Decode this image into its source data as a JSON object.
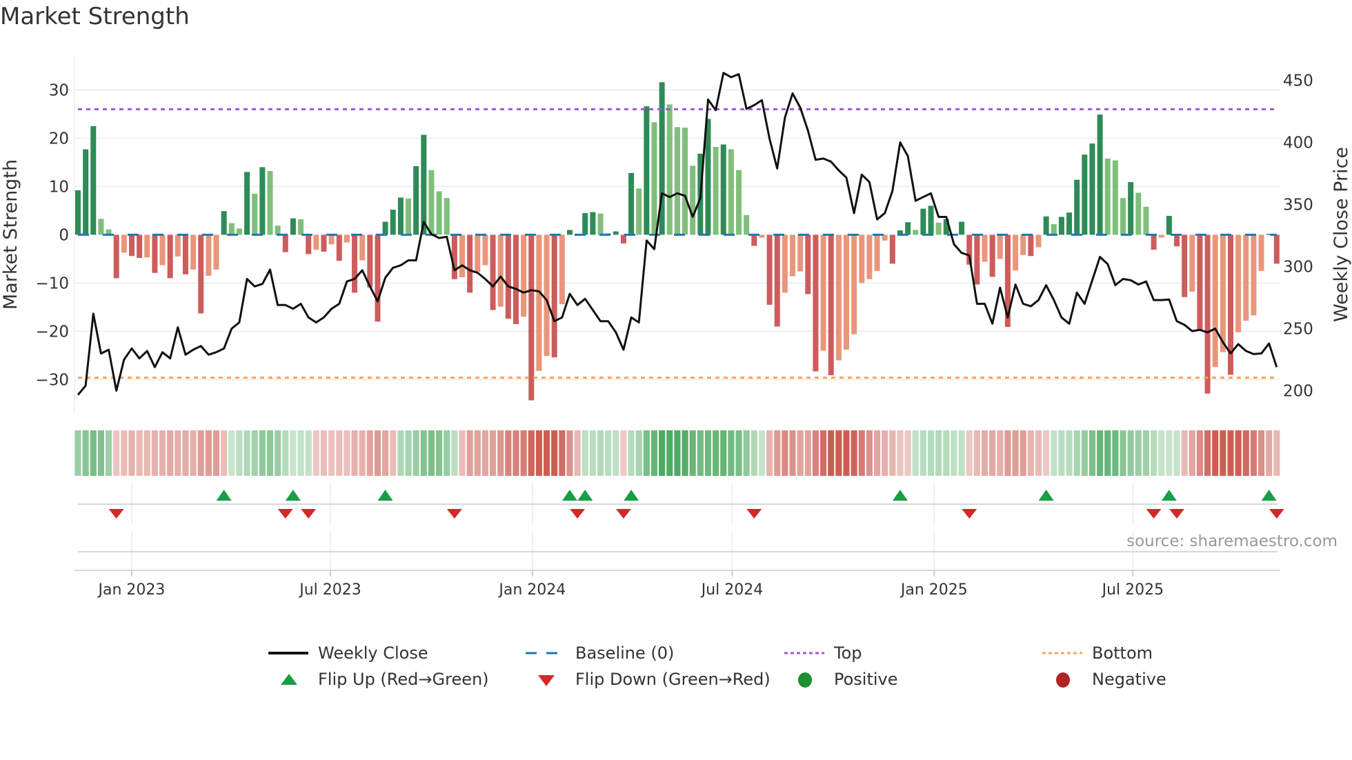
{
  "title": "Market Strength",
  "source": "source: sharemaestro.com",
  "colors": {
    "strong_green": "#2e8b57",
    "weak_green": "#7fbf7b",
    "strong_red": "#cd5c5c",
    "weak_red": "#e9967a",
    "line": "#111111",
    "baseline": "#1f77b4",
    "top": "#9b59d6",
    "bottom": "#f4a460",
    "flip_up": "#1a9e45",
    "flip_down": "#d62728",
    "positive": "#1e8f2e",
    "negative": "#b22222"
  },
  "chart_data": {
    "type": "bar+line",
    "title": "Market Strength",
    "ylabel": "Market Strength",
    "y2label": "Weekly Close Price",
    "ylim": [
      -36,
      36
    ],
    "y2lim": [
      185,
      460
    ],
    "start_date": "2022-11-13",
    "frequency": "weekly",
    "top_level": 26,
    "bottom_level": -29.6,
    "baseline": 0,
    "left_ticks": [
      {
        "value": -30,
        "label": "−30"
      },
      {
        "value": -20,
        "label": "−20"
      },
      {
        "value": -10,
        "label": "−10"
      },
      {
        "value": 0,
        "label": "0"
      },
      {
        "value": 10,
        "label": "10"
      },
      {
        "value": 20,
        "label": "20"
      },
      {
        "value": 30,
        "label": "30"
      }
    ],
    "right_ticks": [
      {
        "value": 200,
        "label": "200"
      },
      {
        "value": 250,
        "label": "250"
      },
      {
        "value": 300,
        "label": "300"
      },
      {
        "value": 350,
        "label": "350"
      },
      {
        "value": 400,
        "label": "400"
      },
      {
        "value": 450,
        "label": "450"
      }
    ],
    "x_ticks": [
      {
        "date": "2023-01-01",
        "label": "Jan 2023"
      },
      {
        "date": "2023-07-01",
        "label": "Jul 2023"
      },
      {
        "date": "2024-01-01",
        "label": "Jan 2024"
      },
      {
        "date": "2024-07-01",
        "label": "Jul 2024"
      },
      {
        "date": "2025-01-01",
        "label": "Jan 2025"
      },
      {
        "date": "2025-07-01",
        "label": "Jul 2025"
      }
    ],
    "strength": [
      9.2,
      17.7,
      22.5,
      3.3,
      1.1,
      -9,
      -3.7,
      -4.4,
      -4.8,
      -4.7,
      -7.9,
      -6.3,
      -9,
      -4.5,
      -8.2,
      -7.2,
      -16.3,
      -8.5,
      -7.2,
      4.9,
      2.4,
      1.3,
      13,
      8.5,
      14,
      13.2,
      1.9,
      -3.6,
      3.4,
      3.2,
      -4,
      -3.1,
      -3.5,
      -2,
      -5.4,
      -1.6,
      -12,
      -5.3,
      -10.9,
      -18,
      2.7,
      5.2,
      7.7,
      7.5,
      14.2,
      20.7,
      13.4,
      9,
      7.6,
      -9.2,
      -8.8,
      -12,
      -7.7,
      -6.3,
      -15.6,
      -14.9,
      -17.4,
      -18.5,
      -17,
      -34.3,
      -28.2,
      -25.1,
      -25.4,
      -14.4,
      1,
      -0.2,
      4.5,
      4.7,
      4.4,
      0.3,
      0.7,
      -1.8,
      12.8,
      9.6,
      26.6,
      23.3,
      31.6,
      27,
      22.3,
      22.2,
      14.3,
      16.8,
      24,
      18.2,
      18.7,
      17.7,
      13.4,
      4.1,
      -2.3,
      -0.6,
      -14.5,
      -19,
      -12,
      -8.6,
      -7.6,
      -12.3,
      -28.3,
      -24,
      -29.1,
      -26,
      -23.8,
      -20.6,
      -10,
      -9.2,
      -7.5,
      -1.2,
      -6,
      0.9,
      2.6,
      1,
      5.4,
      6,
      2.5,
      3.2,
      0.2,
      2.7,
      -6.2,
      -10.3,
      -5.6,
      -8.7,
      -5,
      -19.1,
      -7.4,
      -4.2,
      -4.4,
      -2.6,
      3.8,
      2.2,
      3.7,
      4.6,
      11.4,
      16.6,
      18.9,
      24.9,
      15.8,
      15.4,
      7.6,
      10.9,
      8.7,
      5.8,
      -3.1,
      -0.6,
      3.9,
      -2.4,
      -12.9,
      -11.8,
      -19.7,
      -32.9,
      -27.4,
      -24.3,
      -29,
      -20.2,
      -17.8,
      -16.7,
      -7.5,
      0.2,
      -6
    ],
    "weekly_close": [
      196.6,
      204,
      262,
      230,
      233,
      200,
      225,
      234,
      226,
      232,
      219,
      231,
      226,
      251,
      229,
      233,
      236,
      229,
      231,
      234,
      250,
      255,
      290,
      284,
      286,
      297.5,
      269,
      269,
      266,
      270,
      259,
      255,
      259,
      266,
      270,
      288,
      290,
      297,
      284,
      272,
      291,
      299,
      301,
      305,
      305,
      336,
      326,
      323,
      324,
      297,
      301,
      297,
      295,
      290,
      284,
      292,
      284,
      282,
      279,
      281,
      280,
      273,
      256,
      259,
      278,
      269,
      274,
      265,
      256,
      256,
      247,
      233,
      259,
      255,
      321,
      314,
      359,
      356,
      359,
      357,
      340,
      355,
      434.5,
      426,
      456,
      452.5,
      455,
      427,
      430,
      434,
      403,
      379,
      420,
      439.5,
      428,
      409.5,
      386,
      387,
      384.5,
      377.5,
      371.6,
      343,
      374,
      368,
      338,
      343,
      361,
      400,
      389,
      353,
      356,
      359,
      340,
      340,
      318,
      311,
      309,
      270,
      270,
      254,
      283,
      259,
      285.5,
      270,
      268,
      273,
      285,
      273,
      259,
      254,
      279,
      270,
      289,
      307.7,
      302,
      285,
      290,
      289,
      285.5,
      288,
      273,
      273,
      273.5,
      256,
      253,
      248,
      249,
      247,
      250,
      239,
      230,
      237.5,
      232,
      229.5,
      230,
      238,
      219
    ]
  },
  "legend": [
    {
      "label": "Weekly Close",
      "symbol": "solid-line"
    },
    {
      "label": "Baseline (0)",
      "symbol": "dashed-line"
    },
    {
      "label": "Top",
      "symbol": "dotted-line-purple"
    },
    {
      "label": "Bottom",
      "symbol": "dotted-line-orange"
    },
    {
      "label": "Flip Up (Red→Green)",
      "symbol": "triangle-up"
    },
    {
      "label": "Flip Down (Green→Red)",
      "symbol": "triangle-down"
    },
    {
      "label": "Positive",
      "symbol": "circle-green"
    },
    {
      "label": "Negative",
      "symbol": "circle-red"
    }
  ]
}
